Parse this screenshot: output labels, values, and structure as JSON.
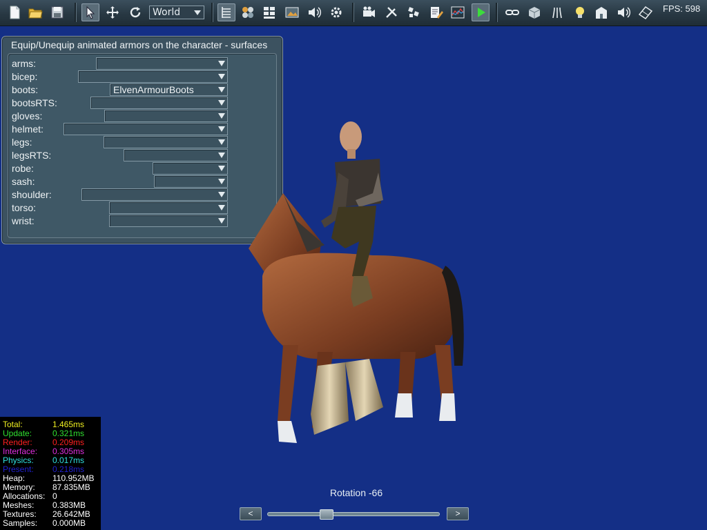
{
  "toolbar": {
    "coordinate_space": "World",
    "fps_label": "FPS: 598"
  },
  "panel": {
    "title": "Equip/Unequip animated armors on the character - surfaces",
    "slots": [
      {
        "label": "arms:",
        "value": ""
      },
      {
        "label": "bicep:",
        "value": ""
      },
      {
        "label": "boots:",
        "value": "ElvenArmourBoots"
      },
      {
        "label": "bootsRTS:",
        "value": ""
      },
      {
        "label": "gloves:",
        "value": ""
      },
      {
        "label": "helmet:",
        "value": ""
      },
      {
        "label": "legs:",
        "value": ""
      },
      {
        "label": "legsRTS:",
        "value": ""
      },
      {
        "label": "robe:",
        "value": ""
      },
      {
        "label": "sash:",
        "value": ""
      },
      {
        "label": "shoulder:",
        "value": ""
      },
      {
        "label": "torso:",
        "value": ""
      },
      {
        "label": "wrist:",
        "value": ""
      }
    ]
  },
  "stats": [
    {
      "label": "Total:",
      "value": "1.465ms",
      "color": "#f0f020"
    },
    {
      "label": "Update:",
      "value": "0.321ms",
      "color": "#30e030"
    },
    {
      "label": "Render:",
      "value": "0.209ms",
      "color": "#ff2020"
    },
    {
      "label": "Interface:",
      "value": "0.305ms",
      "color": "#e030e0"
    },
    {
      "label": "Physics:",
      "value": "0.017ms",
      "color": "#30e0e0"
    },
    {
      "label": "Present:",
      "value": "0.218ms",
      "color": "#2020d0"
    },
    {
      "label": "Heap:",
      "value": "110.952MB",
      "color": "#ffffff"
    },
    {
      "label": "Memory:",
      "value": "87.835MB",
      "color": "#ffffff"
    },
    {
      "label": "Allocations:",
      "value": "0",
      "color": "#ffffff"
    },
    {
      "label": "Meshes:",
      "value": "0.383MB",
      "color": "#ffffff"
    },
    {
      "label": "Textures:",
      "value": "26.642MB",
      "color": "#ffffff"
    },
    {
      "label": "Samples:",
      "value": "0.000MB",
      "color": "#ffffff"
    }
  ],
  "rotation": {
    "label": "Rotation -66",
    "prev_label": "<",
    "next_label": ">",
    "slider_fraction": 0.33
  }
}
